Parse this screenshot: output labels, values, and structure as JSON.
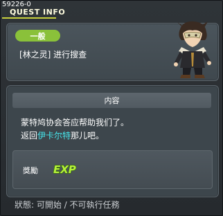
{
  "window": {
    "quest_id": "59226-0",
    "title": "QUEST INFO"
  },
  "quest": {
    "category": "一般",
    "name": "[林之灵] 进行搜查"
  },
  "content": {
    "header": "内容",
    "line1": "蒙特鸠协会答应帮助我们了。",
    "line2_prefix": "返回",
    "line2_npc": "伊卡尔特",
    "line2_suffix": "那儿吧。"
  },
  "reward": {
    "label": "獎勵",
    "icon": "exp-icon",
    "icon_text": "EXP"
  },
  "status": {
    "text": "狀態: 可開始 / 不可執行任務"
  },
  "colors": {
    "accent_green": "#8ac13a",
    "npc_highlight": "#46e6ec",
    "title_underline": "#c9d13f"
  }
}
